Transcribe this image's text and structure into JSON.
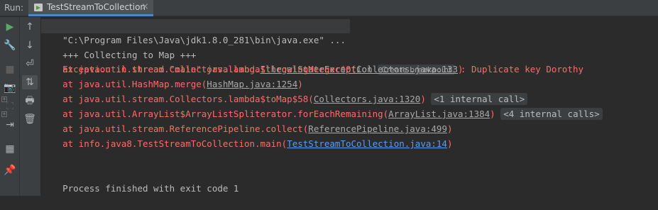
{
  "run_label": "Run:",
  "tab": {
    "title": "TestStreamToCollection",
    "close": "×"
  },
  "toolbar_left": [
    {
      "icon": "▶",
      "color": "#59a869"
    },
    {
      "icon": "🔧",
      "color": "#afb1b3"
    },
    {
      "icon": "■",
      "color": "#5c5c5c"
    },
    {
      "icon": "📷",
      "color": "#5c5c5c"
    },
    {
      "icon": "⛶",
      "color": "#5c5c5c"
    },
    {
      "icon": "⇥",
      "color": "#afb1b3"
    },
    {
      "icon": "▦",
      "color": "#afb1b3"
    },
    {
      "icon": "📌",
      "color": "#afb1b3"
    }
  ],
  "toolbar_right": [
    {
      "icon": "↑",
      "color": "#afb1b3"
    },
    {
      "icon": "↓",
      "color": "#afb1b3"
    },
    {
      "icon": "⏎",
      "color": "#afb1b3"
    },
    {
      "icon": "⇅",
      "color": "#afb1b3"
    },
    {
      "icon": "🖶",
      "color": "#afb1b3"
    },
    {
      "icon": "🗑",
      "color": "#afb1b3"
    }
  ],
  "console": {
    "command": "\"C:\\Program Files\\Java\\jdk1.8.0_281\\bin\\java.exe\" ...",
    "collecting": "+++ Collecting to Map +++",
    "exception_prefix": "Exception in thread \"main\" java.lang.",
    "exception_class": "IllegalStateException",
    "breakpoint_hint": "Create breakpoint",
    "exception_message": " : Duplicate key Dorothy",
    "frames": [
      {
        "prefix": "    at java.util.stream.Collectors.lambda$throwingMerger$0(",
        "link": "Collectors.java:133",
        "suffix": ")",
        "badge": "",
        "fold": false,
        "blue": false
      },
      {
        "prefix": "    at java.util.HashMap.merge(",
        "link": "HashMap.java:1254",
        "suffix": ")",
        "badge": "",
        "fold": false,
        "blue": false
      },
      {
        "prefix": "    at java.util.stream.Collectors.lambda$toMap$58(",
        "link": "Collectors.java:1320",
        "suffix": ") ",
        "badge": "<1 internal call>",
        "fold": true,
        "blue": false
      },
      {
        "prefix": "    at java.util.ArrayList$ArrayListSpliterator.forEachRemaining(",
        "link": "ArrayList.java:1384",
        "suffix": ") ",
        "badge": "<4 internal calls>",
        "fold": true,
        "blue": false
      },
      {
        "prefix": "    at java.util.stream.ReferencePipeline.collect(",
        "link": "ReferencePipeline.java:499",
        "suffix": ")",
        "badge": "",
        "fold": false,
        "blue": false
      },
      {
        "prefix": "    at info.java8.TestStreamToCollection.main(",
        "link": "TestStreamToCollection.java:14",
        "suffix": ")",
        "badge": "",
        "fold": false,
        "blue": true
      }
    ],
    "exit": "Process finished with exit code 1"
  }
}
